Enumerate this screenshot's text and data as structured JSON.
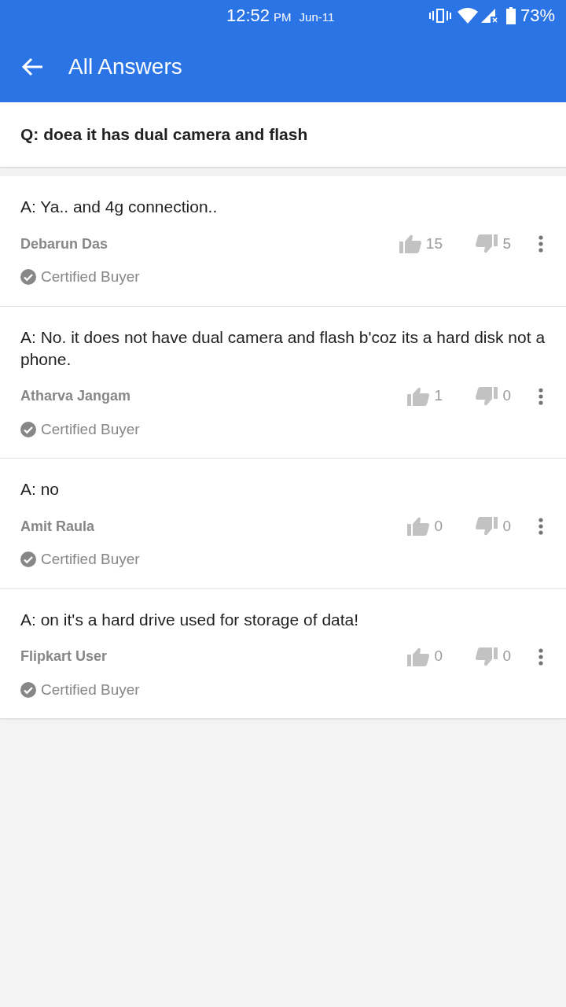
{
  "status_bar": {
    "time": "12:52",
    "ampm": "PM",
    "date": "Jun-11",
    "battery": "73%"
  },
  "app_bar": {
    "title": "All Answers"
  },
  "question": {
    "text": "Q: doea it has dual camera and flash"
  },
  "answers": [
    {
      "text": "A: Ya.. and 4g connection..",
      "author": "Debarun Das",
      "badge": "Certified Buyer",
      "likes": "15",
      "dislikes": "5"
    },
    {
      "text": "A: No. it does not have dual camera and flash b'coz its a hard disk not a phone.",
      "author": "Atharva Jangam",
      "badge": "Certified Buyer",
      "likes": "1",
      "dislikes": "0"
    },
    {
      "text": "A: no",
      "author": "Amit Raula",
      "badge": "Certified Buyer",
      "likes": "0",
      "dislikes": "0"
    },
    {
      "text": "A: on it's a hard drive used for storage of data!",
      "author": "Flipkart User",
      "badge": "Certified Buyer",
      "likes": "0",
      "dislikes": "0"
    }
  ]
}
